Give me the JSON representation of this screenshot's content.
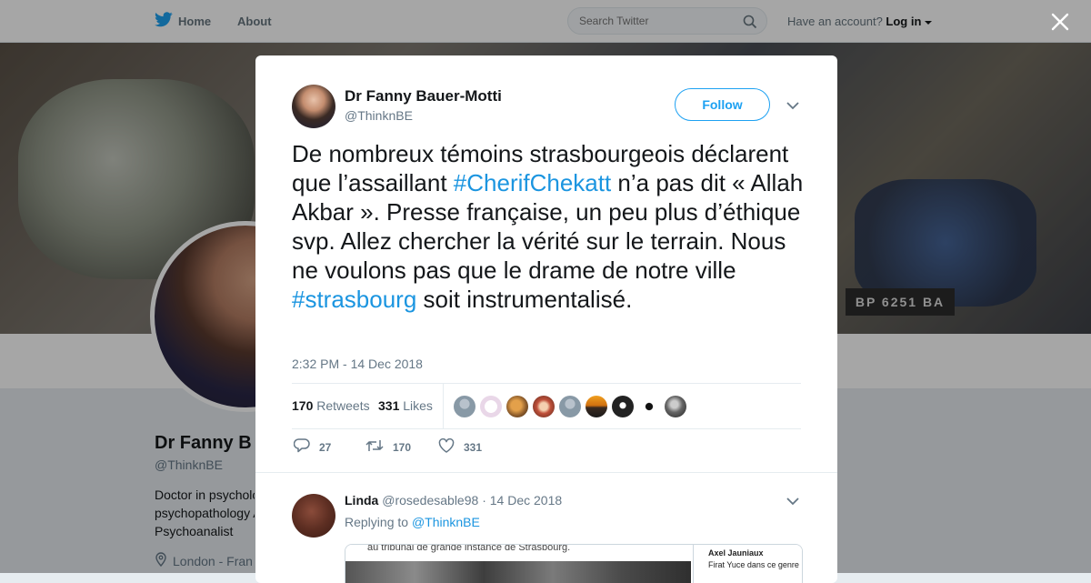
{
  "topbar": {
    "home_label": "Home",
    "about_label": "About",
    "search_placeholder": "Search Twitter",
    "have_account": "Have an account?",
    "login_label": "Log in"
  },
  "profile": {
    "name": "Dr Fanny B",
    "handle": "@ThinknBE",
    "bio_lines": [
      "Doctor in psycholo",
      "psychopathology A",
      "Psychoanalist"
    ],
    "location": "London - Fran",
    "banner_plate": "BP 6251 BA"
  },
  "tweet": {
    "author_name": "Dr Fanny Bauer-Motti",
    "author_handle": "@ThinknBE",
    "follow_label": "Follow",
    "text_parts": {
      "p1": "De nombreux témoins strasbourgeois déclarent que l’assaillant ",
      "tag1": "#CherifChekatt",
      "p2": " n’a pas dit « Allah Akbar ». Presse française, un peu plus d’éthique svp. Allez chercher la vérité sur le terrain. Nous ne voulons pas que le drame de notre ville ",
      "tag2": "#strasbourg",
      "p3": " soit instrumentalisé."
    },
    "timestamp": "2:32 PM - 14 Dec 2018",
    "retweets_count": "170",
    "retweets_label": "Retweets",
    "likes_count": "331",
    "likes_label": "Likes",
    "actions": {
      "reply_count": "27",
      "retweet_count": "170",
      "like_count": "331"
    }
  },
  "reply": {
    "name": "Linda",
    "handle": "@rosedesable98",
    "separator": "·",
    "date": "14 Dec 2018",
    "replying_prefix": "Replying to",
    "replying_handle": "@ThinknBE",
    "media_doc_text": "au tribunal de grande instance de Strasbourg.",
    "media_chat_name": "Axel Jauniaux",
    "media_chat_msg": "Firat Yuce dans ce genre"
  },
  "colors": {
    "accent": "#1da1f2",
    "link": "#1b95e0",
    "text": "#14171a",
    "muted": "#657786"
  },
  "icons": [
    "twitter-bird-icon",
    "search-icon",
    "caret-down-icon",
    "close-icon",
    "reply-icon",
    "retweet-icon",
    "heart-icon",
    "location-pin-icon"
  ]
}
